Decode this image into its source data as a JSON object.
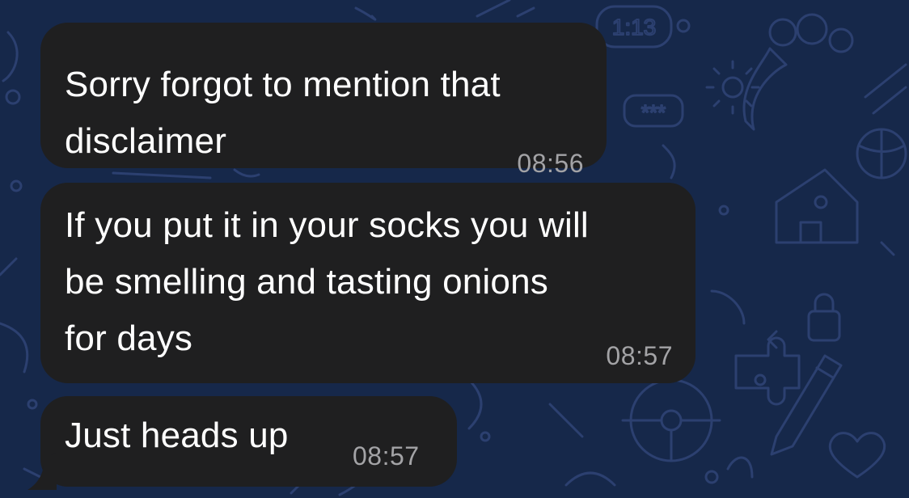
{
  "theme": {
    "background": "#16284a",
    "pattern": "#2c4070",
    "bubble": "#1f1f20",
    "text": "#ffffff",
    "timestamp": "#a3a3a6"
  },
  "wallpaper": {
    "badge_time": "1:13",
    "badge_password": "***"
  },
  "messages": [
    {
      "lines": [
        "Sorry forgot to mention that",
        "disclaimer"
      ],
      "time": "08:56"
    },
    {
      "lines": [
        "If you put it in your socks you will",
        "be smelling and tasting onions",
        "for days"
      ],
      "time": "08:57"
    },
    {
      "lines": [
        "Just heads up"
      ],
      "time": "08:57"
    }
  ]
}
